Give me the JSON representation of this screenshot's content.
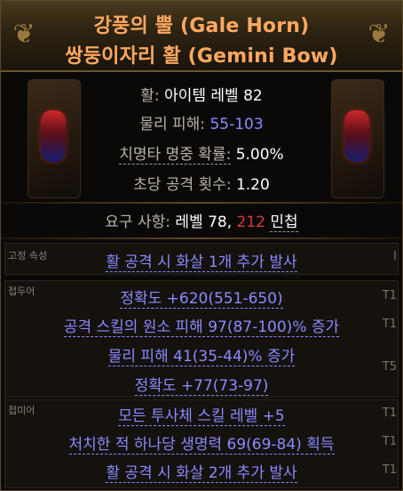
{
  "item": {
    "name": "강풍의 뿔 (Gale Horn)",
    "base": "쌍둥이자리 활 (Gemini Bow)"
  },
  "properties": {
    "class_label": "활:",
    "item_level": "아이템 레벨 82",
    "phys_label": "물리 피해:",
    "phys_value": "55-103",
    "crit_label": "치명타 명중 확률:",
    "crit_value": "5.00%",
    "aps_label": "초당 공격 횟수:",
    "aps_value": "1.20"
  },
  "requirements": {
    "label": "요구 사항:",
    "level": "레벨 78,",
    "dex_value": "212",
    "dex_label": "민첩"
  },
  "implicit": {
    "label": "고정 속성",
    "mod": "활 공격 시 화살 1개 추가 발사",
    "tier_marker": "I"
  },
  "prefix": {
    "label": "접두어",
    "mods": [
      {
        "text": "정확도 +620(551-650)",
        "tier": "T1"
      },
      {
        "text": "공격 스킬의 원소 피해 97(87-100)% 증가",
        "tier": "T1"
      },
      {
        "text": "물리 피해 41(35-44)% 증가",
        "tier": "T5"
      },
      {
        "text": "정확도 +77(73-97)",
        "tier": ""
      }
    ]
  },
  "suffix": {
    "label": "접미어",
    "mods": [
      {
        "text": "모든 투사체 스킬 레벨 +5",
        "tier": "T1"
      },
      {
        "text": "처치한 적 하나당 생명력 69(69-84) 획득",
        "tier": "T1"
      },
      {
        "text": "활 공격 시 화살 2개 추가 발사",
        "tier": "T1"
      }
    ]
  },
  "colors": {
    "title": "#ffa860",
    "magic_mod": "#8b8bff",
    "requirement_unmet": "#d83a3a",
    "border": "#5a4a2e"
  }
}
